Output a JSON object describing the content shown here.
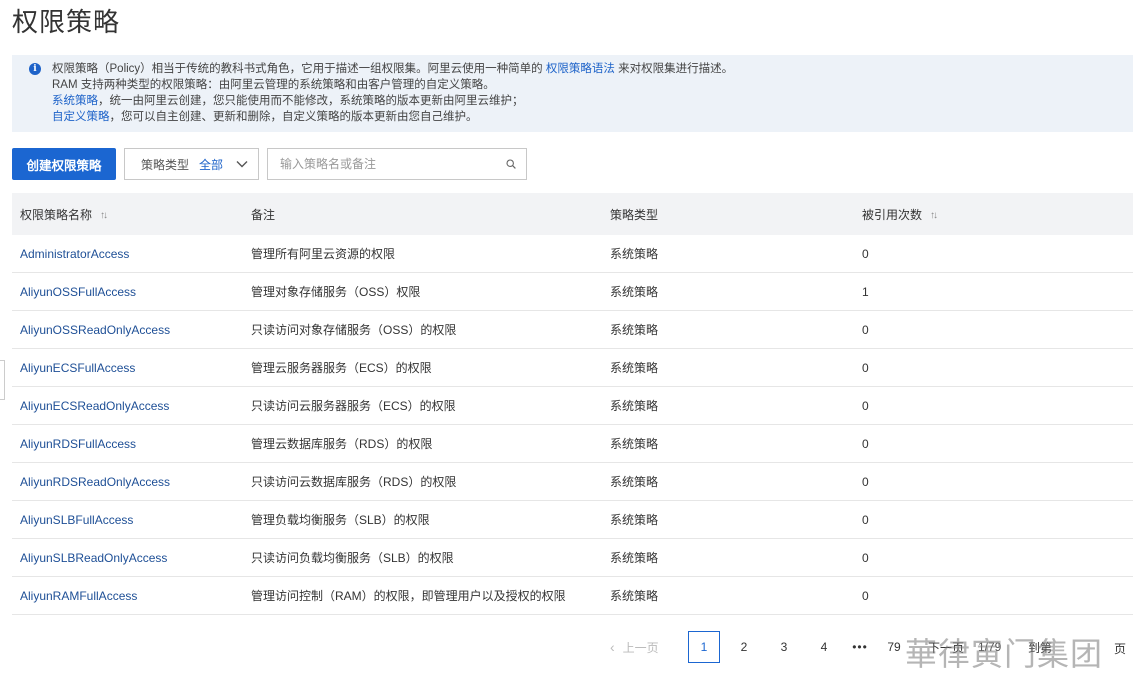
{
  "page": {
    "title": "权限策略"
  },
  "notice": {
    "line1_prefix": "权限策略（Policy）相当于传统的教科书式角色，它用于描述一组权限集。阿里云使用一种简单的",
    "line1_link": "权限策略语法",
    "line1_suffix": "来对权限集进行描述。",
    "line2": "RAM 支持两种类型的权限策略：由阿里云管理的系统策略和由客户管理的自定义策略。",
    "line3_link": "系统策略",
    "line3_text": "，统一由阿里云创建，您只能使用而不能修改，系统策略的版本更新由阿里云维护；",
    "line4_link": "自定义策略",
    "line4_text": "，您可以自主创建、更新和删除，自定义策略的版本更新由您自己维护。",
    "icon": "info-icon"
  },
  "toolbar": {
    "create_label": "创建权限策略",
    "select_label": "策略类型",
    "select_value": "全部",
    "search_placeholder": "输入策略名或备注"
  },
  "table": {
    "headers": {
      "name": "权限策略名称",
      "note": "备注",
      "type": "策略类型",
      "refs": "被引用次数"
    },
    "rows": [
      {
        "name": "AdministratorAccess",
        "note": "管理所有阿里云资源的权限",
        "type": "系统策略",
        "refs": "0"
      },
      {
        "name": "AliyunOSSFullAccess",
        "note": "管理对象存储服务（OSS）权限",
        "type": "系统策略",
        "refs": "1"
      },
      {
        "name": "AliyunOSSReadOnlyAccess",
        "note": "只读访问对象存储服务（OSS）的权限",
        "type": "系统策略",
        "refs": "0"
      },
      {
        "name": "AliyunECSFullAccess",
        "note": "管理云服务器服务（ECS）的权限",
        "type": "系统策略",
        "refs": "0"
      },
      {
        "name": "AliyunECSReadOnlyAccess",
        "note": "只读访问云服务器服务（ECS）的权限",
        "type": "系统策略",
        "refs": "0"
      },
      {
        "name": "AliyunRDSFullAccess",
        "note": "管理云数据库服务（RDS）的权限",
        "type": "系统策略",
        "refs": "0"
      },
      {
        "name": "AliyunRDSReadOnlyAccess",
        "note": "只读访问云数据库服务（RDS）的权限",
        "type": "系统策略",
        "refs": "0"
      },
      {
        "name": "AliyunSLBFullAccess",
        "note": "管理负载均衡服务（SLB）的权限",
        "type": "系统策略",
        "refs": "0"
      },
      {
        "name": "AliyunSLBReadOnlyAccess",
        "note": "只读访问负载均衡服务（SLB）的权限",
        "type": "系统策略",
        "refs": "0"
      },
      {
        "name": "AliyunRAMFullAccess",
        "note": "管理访问控制（RAM）的权限，即管理用户以及授权的权限",
        "type": "系统策略",
        "refs": "0"
      }
    ]
  },
  "pager": {
    "prev": "上一页",
    "pages": [
      "1",
      "2",
      "3",
      "4"
    ],
    "ellipsis": "•••",
    "last": "79",
    "next": "下一页",
    "total": "1/79",
    "jump": "到第",
    "page_suffix": "页",
    "current": "1"
  },
  "watermark": "華律寅门集团",
  "colors": {
    "primary": "#1b66d1",
    "link": "#1e63c9",
    "notice_bg": "#edf2f8",
    "header_bg": "#f2f3f5"
  }
}
